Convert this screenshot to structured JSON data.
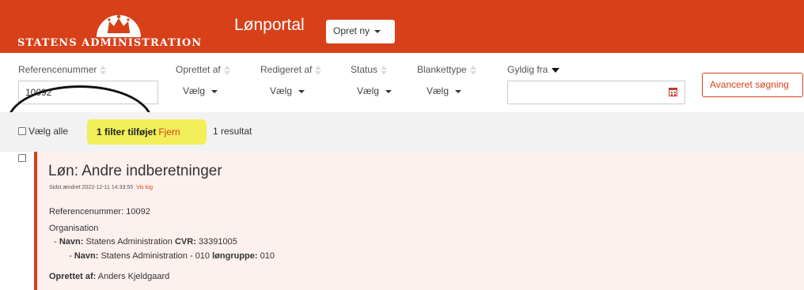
{
  "header": {
    "logo_text": "Statens Administration",
    "app_title": "Lønportal",
    "create_button": "Opret ny"
  },
  "filters": {
    "reference": {
      "label": "Referencenummer",
      "value": "10092"
    },
    "created_by": {
      "label": "Oprettet af",
      "select": "Vælg"
    },
    "edited_by": {
      "label": "Redigeret af",
      "select": "Vælg"
    },
    "status": {
      "label": "Status",
      "select": "Vælg"
    },
    "form_type": {
      "label": "Blankettype",
      "select": "Vælg"
    },
    "valid_from": {
      "label": "Gyldig fra",
      "value": ""
    },
    "advanced_search": "Avanceret søgning"
  },
  "results": {
    "select_all": "Vælg alle",
    "filter_added": "1 filter tilføjet",
    "remove": "Fjern",
    "count": "1 resultat"
  },
  "card": {
    "title": "Løn: Andre indberetninger",
    "modified_prefix": "Sidst ændret",
    "modified": "2022-12-11 14:33:55",
    "view_log": "Vis log",
    "ref_label": "Referencenummer:",
    "ref_value": "10092",
    "org_label": "Organisation",
    "org1_name_label": "Navn:",
    "org1_name": "Statens Administration",
    "org1_cvr_label": "CVR:",
    "org1_cvr": "33391005",
    "org2_name_label": "Navn:",
    "org2_name": "Statens Administration - 010",
    "org2_group_label": "løngruppe:",
    "org2_group": "010",
    "created_by_label": "Oprettet af:",
    "created_by": "Anders Kjeldgaard"
  },
  "colors": {
    "brand": "#d8401a",
    "highlight": "#f2ef5a",
    "card_bg": "#fdf1ee"
  },
  "icons": [
    "crown-logo",
    "sort-icon",
    "sort-down-icon",
    "chevron-down-icon",
    "calendar-icon",
    "checkbox"
  ]
}
